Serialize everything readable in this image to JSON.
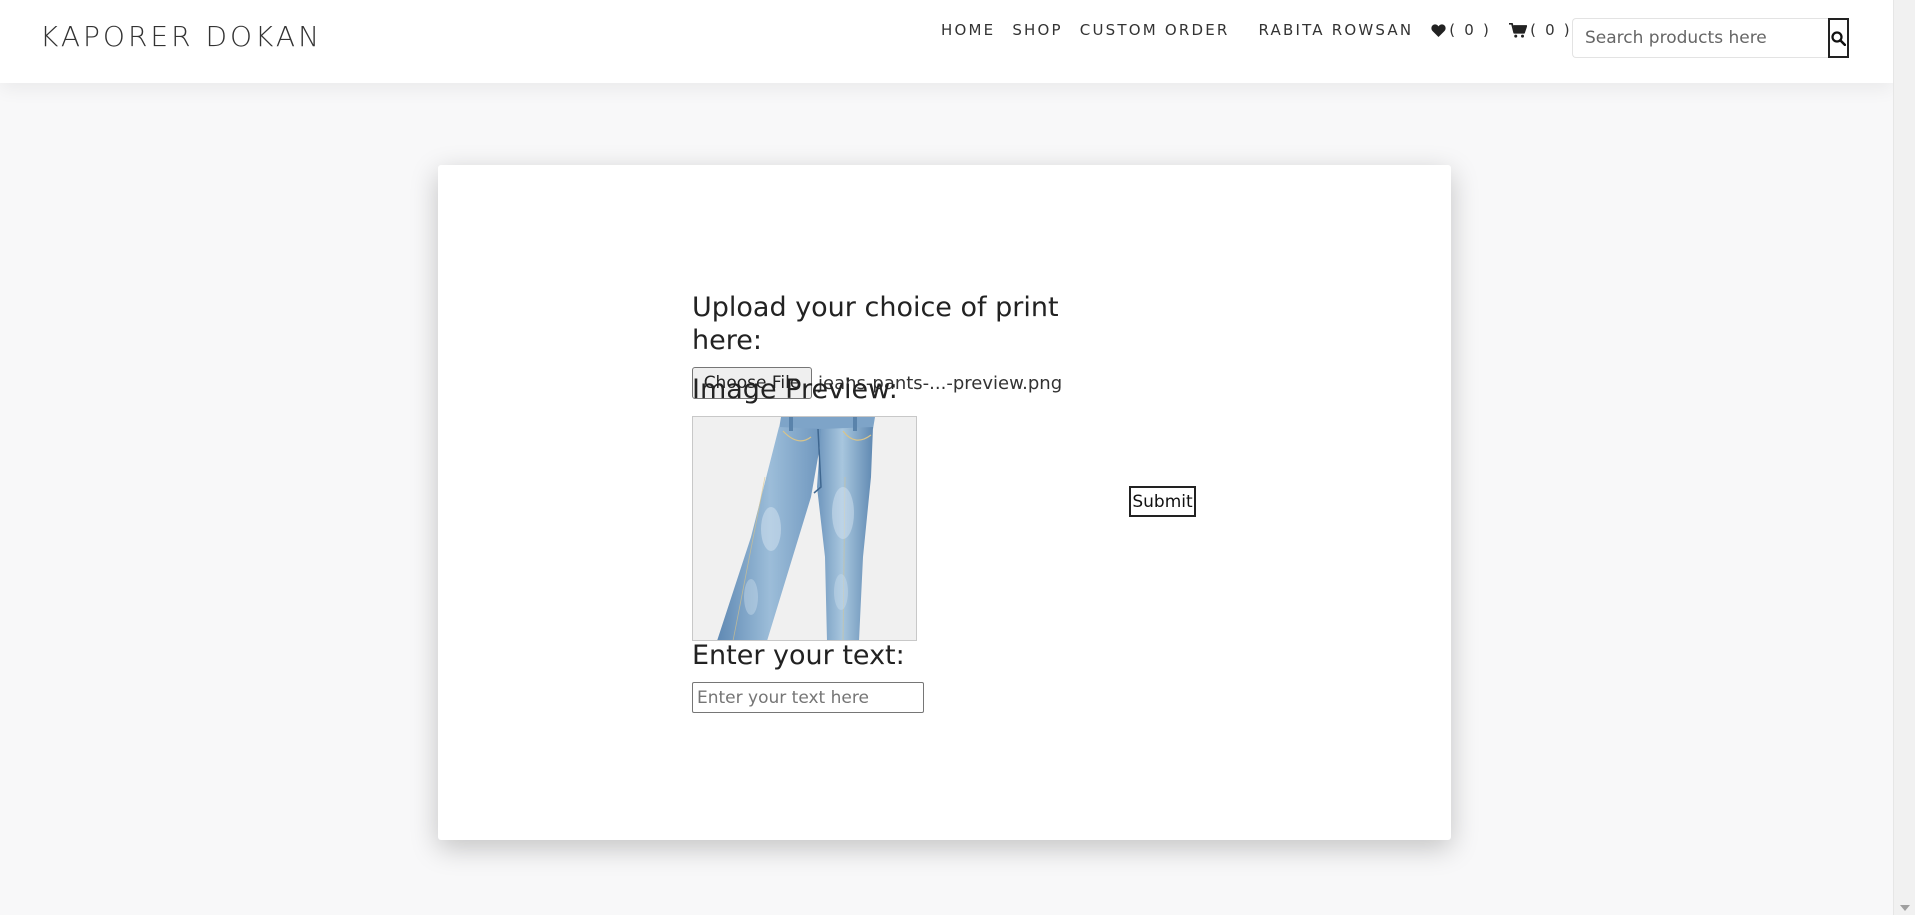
{
  "brand": {
    "name": "KAPORER DOKAN"
  },
  "nav": {
    "home": "HOME",
    "shop": "SHOP",
    "custom_order": "CUSTOM ORDER",
    "user": "RABITA ROWSAN",
    "wishlist_count": "( 0 )",
    "cart_count": "( 0 )"
  },
  "search": {
    "placeholder": "Search products here"
  },
  "form": {
    "upload_heading": "Upload your choice of print here:",
    "file_button": "Choose File",
    "file_name": "jeans-pants-...-preview.png",
    "preview_heading": "Image Preview:",
    "text_heading": "Enter your text:",
    "text_placeholder": "Enter your text here",
    "submit": "Submit"
  },
  "icons": {
    "wishlist": "heart-icon",
    "cart": "cart-icon",
    "search": "search-icon",
    "preview_image": "jeans-image"
  },
  "colors": {
    "page_bg": "#f8f8f9",
    "text": "#222222",
    "jeans_blue": "#8eb3d2"
  }
}
